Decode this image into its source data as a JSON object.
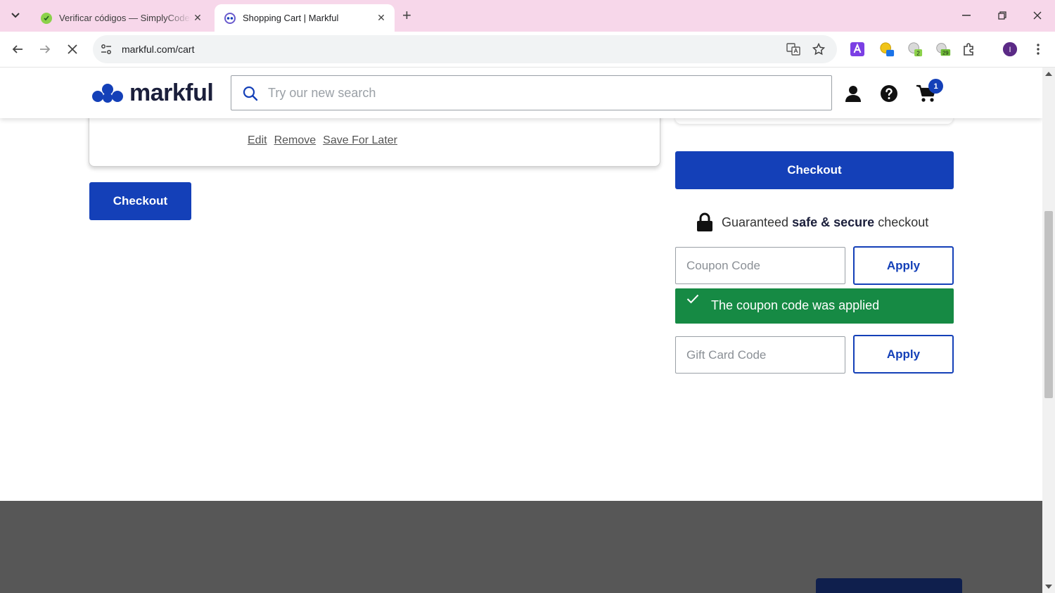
{
  "browser": {
    "tabs": [
      {
        "title": "Verificar códigos — SimplyCodes",
        "active": false
      },
      {
        "title": "Shopping Cart | Markful",
        "active": true
      }
    ],
    "url": "markful.com/cart",
    "extension_badges": {
      "ext2": "",
      "ext3": "2",
      "ext4": "29"
    },
    "profile_initial": "I"
  },
  "header": {
    "logo_text": "markful",
    "search_placeholder": "Try our new search",
    "cart_count": "1"
  },
  "cart_item": {
    "actions": [
      "Edit",
      "Remove",
      "Save For Later"
    ]
  },
  "checkout_label": "Checkout",
  "summary": {
    "checkout_label": "Checkout",
    "secure_prefix": "Guaranteed",
    "secure_bold": "safe & secure",
    "secure_suffix": "checkout",
    "coupon_placeholder": "Coupon Code",
    "apply_label": "Apply",
    "success_message": "The coupon code was applied",
    "gift_placeholder": "Gift Card Code"
  },
  "colors": {
    "brand_blue": "#1440b8",
    "success_green": "#168a44",
    "tabbar_pink": "#f7d7ea",
    "footer_gray": "#575757"
  }
}
